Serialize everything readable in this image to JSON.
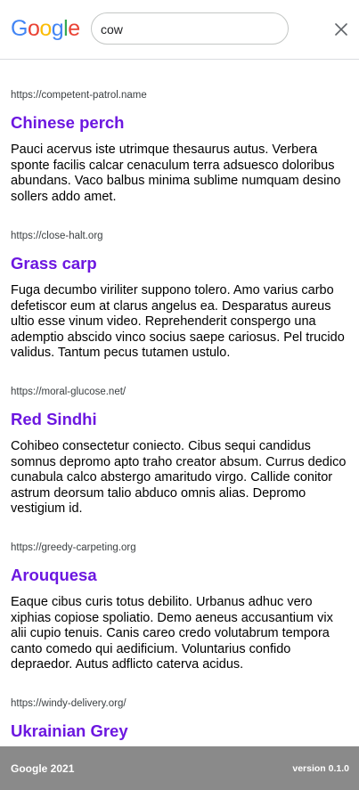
{
  "header": {
    "logo_letters": [
      {
        "char": "G",
        "color": "#4285F4"
      },
      {
        "char": "o",
        "color": "#EA4335"
      },
      {
        "char": "o",
        "color": "#FBBC05"
      },
      {
        "char": "g",
        "color": "#4285F4"
      },
      {
        "char": "l",
        "color": "#34A853"
      },
      {
        "char": "e",
        "color": "#EA4335"
      }
    ],
    "search_value": "cow",
    "close_icon": "close-icon"
  },
  "results": [
    {
      "url": "https://competent-patrol.name",
      "title": "Chinese perch",
      "snippet": "Pauci acervus iste utrimque thesaurus autus. Verbera sponte facilis calcar cenaculum terra adsuesco doloribus abundans. Vaco balbus minima sublime numquam desino sollers addo amet."
    },
    {
      "url": "https://close-halt.org",
      "title": "Grass carp",
      "snippet": "Fuga decumbo viriliter suppono tolero. Amo varius carbo defetiscor eum at clarus angelus ea. Desparatus aureus ultio esse vinum video. Reprehenderit conspergo una ademptio abscido vinco socius saepe cariosus. Pel trucido validus. Tantum pecus tutamen ustulo."
    },
    {
      "url": "https://moral-glucose.net/",
      "title": "Red Sindhi",
      "snippet": "Cohibeo consectetur coniecto. Cibus sequi candidus somnus depromo apto traho creator absum. Currus dedico cunabula calco abstergo amaritudo virgo. Callide conitor astrum deorsum talio abduco omnis alias. Depromo vestigium id."
    },
    {
      "url": "https://greedy-carpeting.org",
      "title": "Arouquesa",
      "snippet": "Eaque cibus curis totus debilito. Urbanus adhuc vero xiphias copiose spoliatio. Demo aeneus accusantium vix alii cupio tenuis. Canis careo credo volutabrum tempora canto comedo qui aedificium. Voluntarius confido depraedor. Autus adflicto caterva acidus."
    },
    {
      "url": "https://windy-delivery.org/",
      "title": "Ukrainian Grey",
      "snippet": ""
    }
  ],
  "footer": {
    "copyright": "Google 2021",
    "version": "version 0.1.0"
  }
}
